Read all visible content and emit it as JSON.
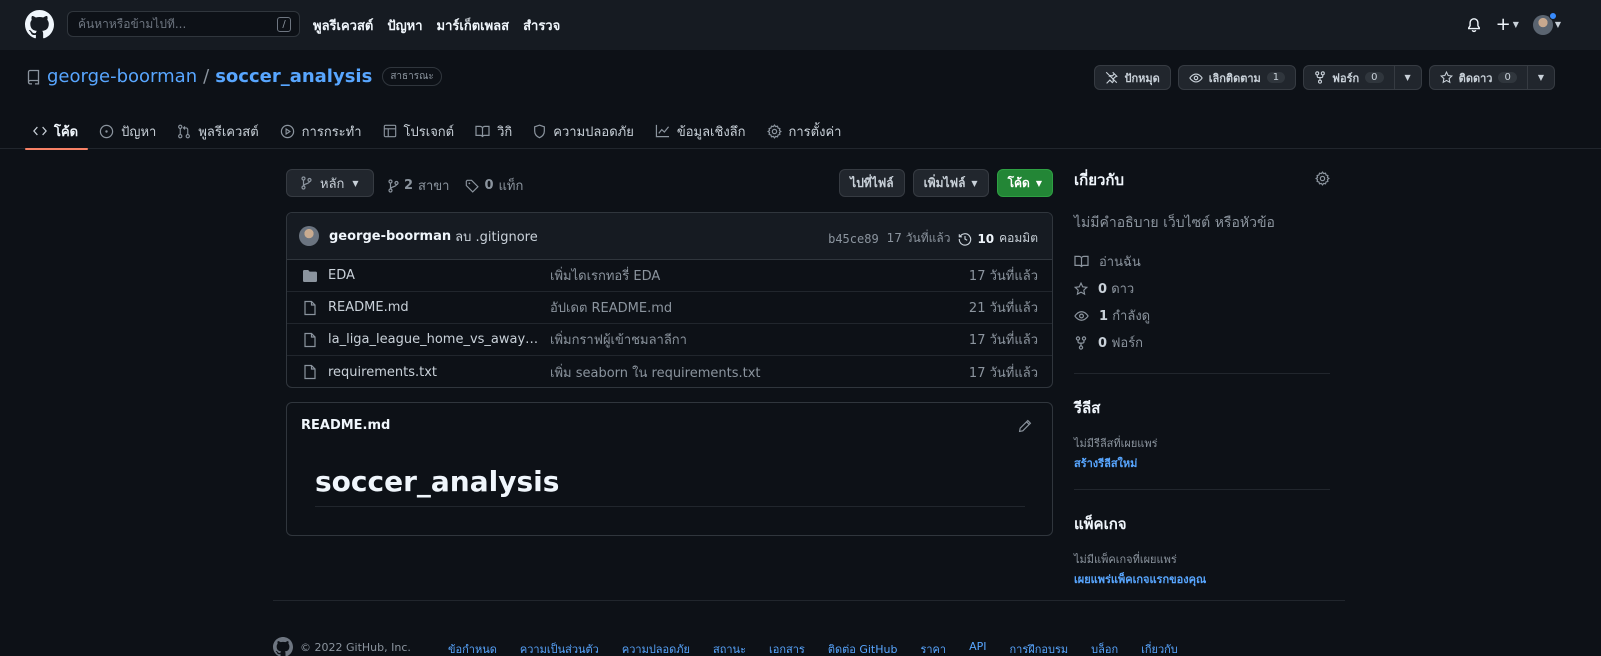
{
  "header": {
    "search_placeholder": "ค้นหาหรือข้ามไปที่...",
    "search_shortcut": "/",
    "nav": [
      "พูลรีเควสต์",
      "ปัญหา",
      "มาร์เก็ตเพลส",
      "สำรวจ"
    ],
    "plus_label": "+"
  },
  "repo": {
    "owner": "george-boorman",
    "separator": "/",
    "name": "soccer_analysis",
    "visibility": "สาธารณะ",
    "pin_label": "ปักหมุด",
    "watch_label": "เลิกติดตาม",
    "watch_count": "1",
    "fork_label": "ฟอร์ก",
    "fork_count": "0",
    "star_label": "ติดดาว",
    "star_count": "0"
  },
  "tabs": [
    {
      "label": "โค้ด",
      "icon": "code-icon",
      "active": true
    },
    {
      "label": "ปัญหา",
      "icon": "issue-icon"
    },
    {
      "label": "พูลรีเควสต์",
      "icon": "pull-request-icon"
    },
    {
      "label": "การกระทำ",
      "icon": "play-icon"
    },
    {
      "label": "โปรเจกต์",
      "icon": "table-icon"
    },
    {
      "label": "วิกิ",
      "icon": "book-icon"
    },
    {
      "label": "ความปลอดภัย",
      "icon": "shield-icon"
    },
    {
      "label": "ข้อมูลเชิงลึก",
      "icon": "graph-icon"
    },
    {
      "label": "การตั้งค่า",
      "icon": "gear-icon"
    }
  ],
  "branch": {
    "current": "หลัก",
    "branch_count": "2",
    "branch_label": "สาขา",
    "tag_count": "0",
    "tag_label": "แท็ก",
    "goto_file": "ไปที่ไฟล์",
    "add_file": "เพิ่มไฟล์",
    "code": "โค้ด"
  },
  "commit": {
    "author": "george-boorman",
    "message": "ลบ .gitignore",
    "sha": "b45ce89",
    "time": "17 วันที่แล้ว",
    "count": "10",
    "count_label": "คอมมิต"
  },
  "files": [
    {
      "type": "folder",
      "name": "EDA",
      "message": "เพิ่มไดเรกทอรี่ EDA",
      "date": "17 วันที่แล้ว"
    },
    {
      "type": "file",
      "name": "README.md",
      "message": "อัปเดต README.md",
      "date": "21 วันที่แล้ว"
    },
    {
      "type": "file",
      "name": "la_liga_league_home_vs_away_att...",
      "message": "เพิ่มกราฟผู้เข้าชมลาลีกา",
      "date": "17 วันที่แล้ว"
    },
    {
      "type": "file",
      "name": "requirements.txt",
      "message": "เพิ่ม seaborn ใน requirements.txt",
      "date": "17 วันที่แล้ว"
    }
  ],
  "readme": {
    "filename": "README.md",
    "heading": "soccer_analysis"
  },
  "sidebar": {
    "about_title": "เกี่ยวกับ",
    "about_desc": "ไม่มีคำอธิบาย เว็บไซต์ หรือหัวข้อ",
    "readme_label": "อ่านฉัน",
    "stars_count": "0",
    "stars_label": "ดาว",
    "watching_count": "1",
    "watching_label": "กำลังดู",
    "forks_count": "0",
    "forks_label": "ฟอร์ก",
    "releases_title": "รีลีส",
    "releases_empty": "ไม่มีรีลีสที่เผยแพร่",
    "releases_link": "สร้างรีลีสใหม่",
    "packages_title": "แพ็คเกจ",
    "packages_empty": "ไม่มีแพ็คเกจที่เผยแพร่",
    "packages_link": "เผยแพร่แพ็คเกจแรกของคุณ"
  },
  "footer": {
    "copyright": "© 2022 GitHub, Inc.",
    "links": [
      "ข้อกำหนด",
      "ความเป็นส่วนตัว",
      "ความปลอดภัย",
      "สถานะ",
      "เอกสาร",
      "ติดต่อ GitHub",
      "ราคา",
      "API",
      "การฝึกอบรม",
      "บล็อก",
      "เกี่ยวกับ"
    ]
  },
  "colors": {
    "background": "#0d1117",
    "header": "#161b22",
    "link": "#58a6ff",
    "accent_tab": "#f78166",
    "green_button": "#238636"
  }
}
